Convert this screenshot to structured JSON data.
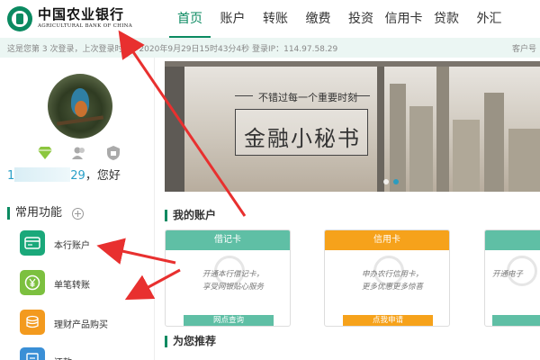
{
  "header": {
    "logo_cn": "中国农业银行",
    "logo_en": "AGRICULTURAL BANK OF CHINA",
    "nav": [
      "首页",
      "账户",
      "转账",
      "缴费",
      "投资",
      "信用卡",
      "贷款",
      "外汇"
    ],
    "active_nav": "首页",
    "accent_color": "#0b8a61"
  },
  "info_bar": {
    "login_info": "这是您第 3 次登录，上次登录时间：2020年9月29日15时43分4秒    登录IP：114.97.58.29",
    "customer_no": "客户号"
  },
  "user": {
    "avatar_icon": "kingfisher-avatar",
    "level_icons": [
      "diamond-icon",
      "users-icon",
      "shield-icon"
    ],
    "name_prefix": "1",
    "name_suffix": "29",
    "greeting": "，您好"
  },
  "functions": {
    "title": "常用功能",
    "items": [
      {
        "label": "本行账户",
        "icon": "card-icon",
        "color": "#1aa87a"
      },
      {
        "label": "单笔转账",
        "icon": "yuan-icon",
        "color": "#7cc03f"
      },
      {
        "label": "理财产品购买",
        "icon": "coins-icon",
        "color": "#f39a1e"
      },
      {
        "label": "还款",
        "icon": "bill-icon",
        "color": "#3a8fd6"
      }
    ]
  },
  "banner": {
    "slogan": "不错过每一个重要时刻",
    "title": "金融小秘书"
  },
  "accounts": {
    "title": "我的账户",
    "cards": [
      {
        "title": "借记卡",
        "desc": "开通本行借记卡，\n享受网银贴心服务",
        "button": "网点查询",
        "color": "#5fbfa5"
      },
      {
        "title": "信用卡",
        "desc": "申办农行信用卡，\n更多优惠更多惊喜",
        "button": "点我申请",
        "color": "#f6a21b"
      },
      {
        "title": "",
        "desc": "开通电子",
        "button": "",
        "color": "#5fbfa5"
      }
    ]
  },
  "recommend": {
    "title": "为您推荐"
  }
}
